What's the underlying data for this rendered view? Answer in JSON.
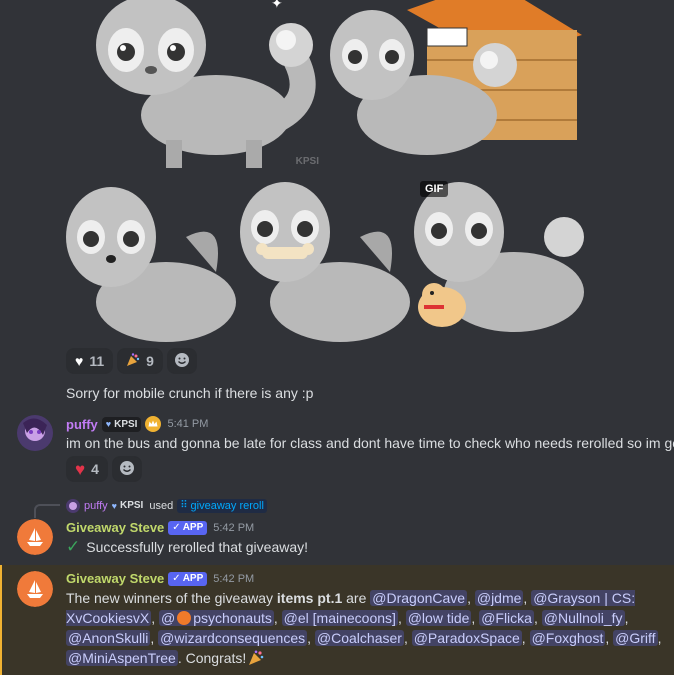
{
  "gallery": {
    "watermark_text": "KPSI",
    "gif_badge": "GIF"
  },
  "reactions_1": [
    {
      "emoji": "white-heart",
      "count": "11"
    },
    {
      "emoji": "party-popper",
      "count": "9"
    }
  ],
  "message_caption": "Sorry for mobile crunch if there is any :p",
  "puffy_message": {
    "username": "puffy",
    "guild_tag": "KPSI",
    "timestamp": "5:41 PM",
    "text": "im on the bus and gonna be late for class and dont have time to check who needs rerolled so im going t",
    "reactions": [
      {
        "emoji": "red-heart",
        "count": "4"
      }
    ]
  },
  "command_usage": {
    "username": "puffy",
    "guild_tag": "KPSI",
    "used_text": "used",
    "command": "giveaway reroll"
  },
  "bot_message_1": {
    "username": "Giveaway Steve",
    "app_tag": "APP",
    "timestamp": "5:42 PM",
    "text": "Successfully rerolled that giveaway!"
  },
  "bot_message_2": {
    "username": "Giveaway Steve",
    "app_tag": "APP",
    "timestamp": "5:42 PM",
    "intro": "The new winners of the giveaway ",
    "bold": "items pt.1",
    "are": " are ",
    "mentions": [
      "@DragonCave",
      "@jdme",
      "@Grayson | CS: XvCookiesvX",
      "@",
      "psychonauts",
      "@el [mainecoons]",
      "@low tide",
      "@Flicka",
      "@Nullnoli_fy",
      "@AnonSkulli",
      "@wizardconsequences",
      "@Coalchaser",
      "@ParadoxSpace",
      "@Foxghost",
      "@Griff",
      "@MiniAspenTree"
    ],
    "outro": ". Congrats!"
  },
  "colors": {
    "background": "#313338",
    "puffy_name": "#c27cf5",
    "bot_name": "#c0d86b",
    "mention_bg": "#3c4270",
    "highlight_bg": "#3a3528",
    "highlight_bar": "#f0b232"
  }
}
